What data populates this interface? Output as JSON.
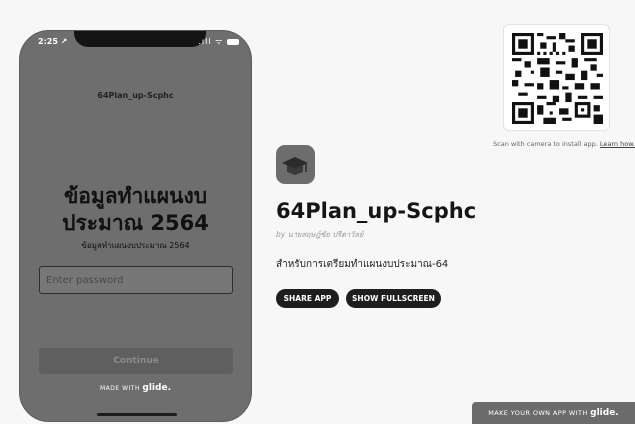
{
  "phone": {
    "status_time": "2:25 ↗",
    "status_icons": ".ıll ᯤ",
    "title": "64Plan_up-Scphc",
    "heading_line1": "ข้อมูลทำแผนงบ",
    "heading_line2": "ประมาณ 2564",
    "subheading": "ข้อมูลทำแผนงบประมาณ 2564",
    "password_placeholder": "Enter password",
    "continue_label": "Continue",
    "made_with_prefix": "MADE WITH",
    "made_with_brand": "glide."
  },
  "qr": {
    "caption": "Scan with camera to install app.",
    "learn_link": "Learn how."
  },
  "app": {
    "name": "64Plan_up-Scphc",
    "author": "by นายสฤษฎ์ชัย ปรีดาวัลย์",
    "description": "สำหรับการเตรียมทำแผนงบประมาณ-64",
    "share_label": "SHARE APP",
    "fullscreen_label": "SHOW FULLSCREEN",
    "icon": "graduation-cap-icon"
  },
  "footer": {
    "make_own_prefix": "MAKE YOUR OWN APP WITH",
    "make_own_brand": "glide."
  }
}
